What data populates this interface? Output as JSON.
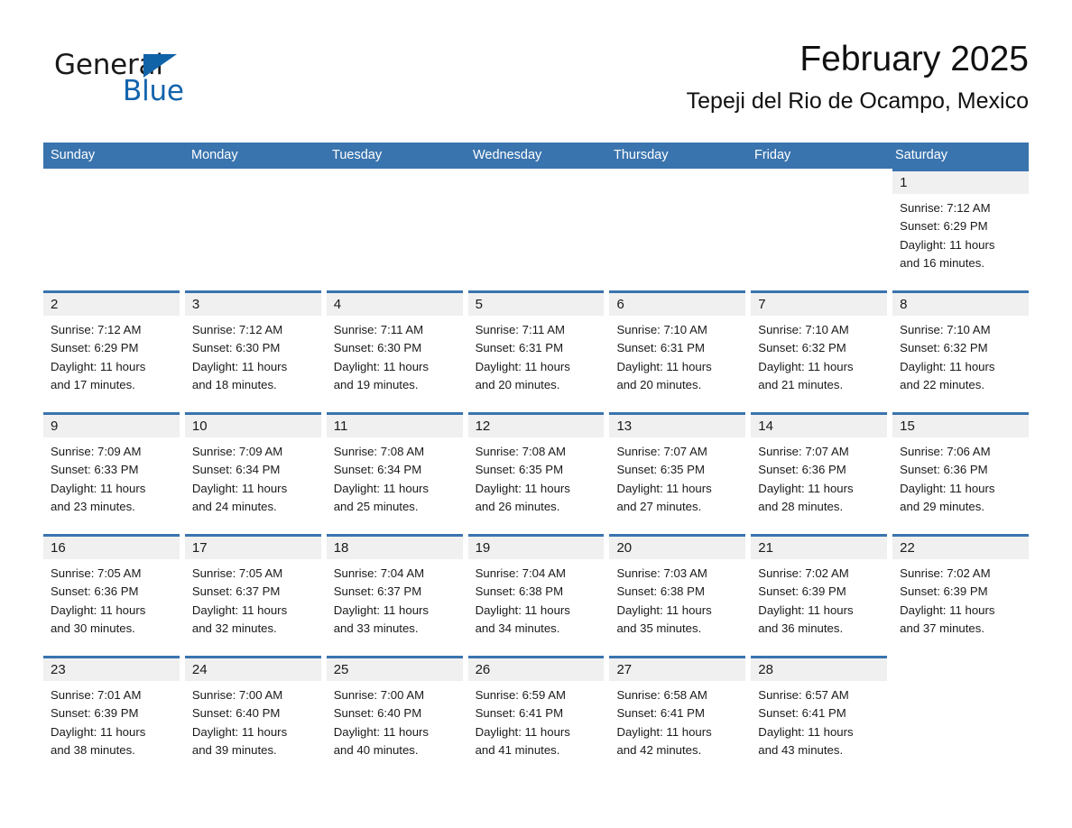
{
  "brand": {
    "name_part1": "General",
    "name_part2": "Blue",
    "triangle_color": "#1163a8",
    "blue_color": "#1263ac"
  },
  "header": {
    "month_title": "February 2025",
    "location": "Tepeji del Rio de Ocampo, Mexico",
    "accent_color": "#3a74ae",
    "day_band_color": "#f0f0f0"
  },
  "weekdays": [
    "Sunday",
    "Monday",
    "Tuesday",
    "Wednesday",
    "Thursday",
    "Friday",
    "Saturday"
  ],
  "weeks": [
    [
      {
        "empty": true
      },
      {
        "empty": true
      },
      {
        "empty": true
      },
      {
        "empty": true
      },
      {
        "empty": true
      },
      {
        "empty": true
      },
      {
        "empty": false,
        "day": "1",
        "sunrise": "Sunrise: 7:12 AM",
        "sunset": "Sunset: 6:29 PM",
        "daylight1": "Daylight: 11 hours",
        "daylight2": "and 16 minutes."
      }
    ],
    [
      {
        "empty": false,
        "day": "2",
        "sunrise": "Sunrise: 7:12 AM",
        "sunset": "Sunset: 6:29 PM",
        "daylight1": "Daylight: 11 hours",
        "daylight2": "and 17 minutes."
      },
      {
        "empty": false,
        "day": "3",
        "sunrise": "Sunrise: 7:12 AM",
        "sunset": "Sunset: 6:30 PM",
        "daylight1": "Daylight: 11 hours",
        "daylight2": "and 18 minutes."
      },
      {
        "empty": false,
        "day": "4",
        "sunrise": "Sunrise: 7:11 AM",
        "sunset": "Sunset: 6:30 PM",
        "daylight1": "Daylight: 11 hours",
        "daylight2": "and 19 minutes."
      },
      {
        "empty": false,
        "day": "5",
        "sunrise": "Sunrise: 7:11 AM",
        "sunset": "Sunset: 6:31 PM",
        "daylight1": "Daylight: 11 hours",
        "daylight2": "and 20 minutes."
      },
      {
        "empty": false,
        "day": "6",
        "sunrise": "Sunrise: 7:10 AM",
        "sunset": "Sunset: 6:31 PM",
        "daylight1": "Daylight: 11 hours",
        "daylight2": "and 20 minutes."
      },
      {
        "empty": false,
        "day": "7",
        "sunrise": "Sunrise: 7:10 AM",
        "sunset": "Sunset: 6:32 PM",
        "daylight1": "Daylight: 11 hours",
        "daylight2": "and 21 minutes."
      },
      {
        "empty": false,
        "day": "8",
        "sunrise": "Sunrise: 7:10 AM",
        "sunset": "Sunset: 6:32 PM",
        "daylight1": "Daylight: 11 hours",
        "daylight2": "and 22 minutes."
      }
    ],
    [
      {
        "empty": false,
        "day": "9",
        "sunrise": "Sunrise: 7:09 AM",
        "sunset": "Sunset: 6:33 PM",
        "daylight1": "Daylight: 11 hours",
        "daylight2": "and 23 minutes."
      },
      {
        "empty": false,
        "day": "10",
        "sunrise": "Sunrise: 7:09 AM",
        "sunset": "Sunset: 6:34 PM",
        "daylight1": "Daylight: 11 hours",
        "daylight2": "and 24 minutes."
      },
      {
        "empty": false,
        "day": "11",
        "sunrise": "Sunrise: 7:08 AM",
        "sunset": "Sunset: 6:34 PM",
        "daylight1": "Daylight: 11 hours",
        "daylight2": "and 25 minutes."
      },
      {
        "empty": false,
        "day": "12",
        "sunrise": "Sunrise: 7:08 AM",
        "sunset": "Sunset: 6:35 PM",
        "daylight1": "Daylight: 11 hours",
        "daylight2": "and 26 minutes."
      },
      {
        "empty": false,
        "day": "13",
        "sunrise": "Sunrise: 7:07 AM",
        "sunset": "Sunset: 6:35 PM",
        "daylight1": "Daylight: 11 hours",
        "daylight2": "and 27 minutes."
      },
      {
        "empty": false,
        "day": "14",
        "sunrise": "Sunrise: 7:07 AM",
        "sunset": "Sunset: 6:36 PM",
        "daylight1": "Daylight: 11 hours",
        "daylight2": "and 28 minutes."
      },
      {
        "empty": false,
        "day": "15",
        "sunrise": "Sunrise: 7:06 AM",
        "sunset": "Sunset: 6:36 PM",
        "daylight1": "Daylight: 11 hours",
        "daylight2": "and 29 minutes."
      }
    ],
    [
      {
        "empty": false,
        "day": "16",
        "sunrise": "Sunrise: 7:05 AM",
        "sunset": "Sunset: 6:36 PM",
        "daylight1": "Daylight: 11 hours",
        "daylight2": "and 30 minutes."
      },
      {
        "empty": false,
        "day": "17",
        "sunrise": "Sunrise: 7:05 AM",
        "sunset": "Sunset: 6:37 PM",
        "daylight1": "Daylight: 11 hours",
        "daylight2": "and 32 minutes."
      },
      {
        "empty": false,
        "day": "18",
        "sunrise": "Sunrise: 7:04 AM",
        "sunset": "Sunset: 6:37 PM",
        "daylight1": "Daylight: 11 hours",
        "daylight2": "and 33 minutes."
      },
      {
        "empty": false,
        "day": "19",
        "sunrise": "Sunrise: 7:04 AM",
        "sunset": "Sunset: 6:38 PM",
        "daylight1": "Daylight: 11 hours",
        "daylight2": "and 34 minutes."
      },
      {
        "empty": false,
        "day": "20",
        "sunrise": "Sunrise: 7:03 AM",
        "sunset": "Sunset: 6:38 PM",
        "daylight1": "Daylight: 11 hours",
        "daylight2": "and 35 minutes."
      },
      {
        "empty": false,
        "day": "21",
        "sunrise": "Sunrise: 7:02 AM",
        "sunset": "Sunset: 6:39 PM",
        "daylight1": "Daylight: 11 hours",
        "daylight2": "and 36 minutes."
      },
      {
        "empty": false,
        "day": "22",
        "sunrise": "Sunrise: 7:02 AM",
        "sunset": "Sunset: 6:39 PM",
        "daylight1": "Daylight: 11 hours",
        "daylight2": "and 37 minutes."
      }
    ],
    [
      {
        "empty": false,
        "day": "23",
        "sunrise": "Sunrise: 7:01 AM",
        "sunset": "Sunset: 6:39 PM",
        "daylight1": "Daylight: 11 hours",
        "daylight2": "and 38 minutes."
      },
      {
        "empty": false,
        "day": "24",
        "sunrise": "Sunrise: 7:00 AM",
        "sunset": "Sunset: 6:40 PM",
        "daylight1": "Daylight: 11 hours",
        "daylight2": "and 39 minutes."
      },
      {
        "empty": false,
        "day": "25",
        "sunrise": "Sunrise: 7:00 AM",
        "sunset": "Sunset: 6:40 PM",
        "daylight1": "Daylight: 11 hours",
        "daylight2": "and 40 minutes."
      },
      {
        "empty": false,
        "day": "26",
        "sunrise": "Sunrise: 6:59 AM",
        "sunset": "Sunset: 6:41 PM",
        "daylight1": "Daylight: 11 hours",
        "daylight2": "and 41 minutes."
      },
      {
        "empty": false,
        "day": "27",
        "sunrise": "Sunrise: 6:58 AM",
        "sunset": "Sunset: 6:41 PM",
        "daylight1": "Daylight: 11 hours",
        "daylight2": "and 42 minutes."
      },
      {
        "empty": false,
        "day": "28",
        "sunrise": "Sunrise: 6:57 AM",
        "sunset": "Sunset: 6:41 PM",
        "daylight1": "Daylight: 11 hours",
        "daylight2": "and 43 minutes."
      },
      {
        "empty": true
      }
    ]
  ]
}
